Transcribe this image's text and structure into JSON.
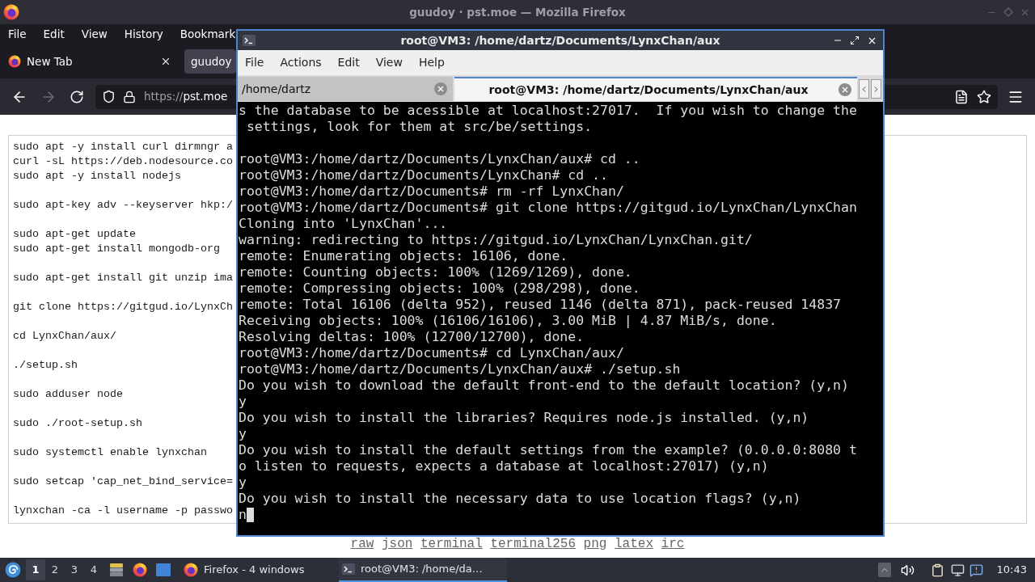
{
  "firefox": {
    "title": "guudoy · pst.moe — Mozilla Firefox",
    "menu": [
      "File",
      "Edit",
      "View",
      "History",
      "Bookmark"
    ],
    "tabs": [
      {
        "label": "New Tab",
        "kind": "new_tab",
        "selected": false,
        "closable": true
      },
      {
        "label": "guudoy",
        "kind": "page",
        "selected": true,
        "closable": false
      }
    ],
    "back": {
      "disabled": false
    },
    "forward": {
      "disabled": true
    },
    "url": {
      "scheme": "https://",
      "host": "pst.moe"
    },
    "page": {
      "code_blocks": [
        [
          "sudo apt -y install curl dirmngr a",
          "curl -sL https://deb.nodesource.co",
          "sudo apt -y install nodejs"
        ],
        [
          "sudo apt-key adv --keyserver hkp:/"
        ],
        [
          "sudo apt-get update",
          "sudo apt-get install mongodb-org"
        ],
        [
          "sudo apt-get install git unzip ima"
        ],
        [
          "git clone https://gitgud.io/LynxCh"
        ],
        [
          "cd LynxChan/aux/"
        ],
        [
          "./setup.sh"
        ],
        [
          "sudo adduser node"
        ],
        [
          "sudo ./root-setup.sh"
        ],
        [
          "sudo systemctl enable lynxchan"
        ],
        [
          "sudo setcap 'cap_net_bind_service="
        ],
        [
          "lynxchan -ca -l username -p passwo"
        ]
      ],
      "links": [
        "raw",
        "json",
        "terminal",
        "terminal256",
        "png",
        "latex",
        "irc"
      ]
    }
  },
  "terminal": {
    "title": "root@VM3: /home/dartz/Documents/LynxChan/aux",
    "menu": [
      "File",
      "Actions",
      "Edit",
      "View",
      "Help"
    ],
    "tabs": [
      {
        "label": "/home/dartz",
        "selected": false
      },
      {
        "label": "root@VM3: /home/dartz/Documents/LynxChan/aux",
        "selected": true
      }
    ],
    "output_blocks": [
      [
        "s the database to be acessible at localhost:27017.  If you wish to change the",
        " settings, look for them at src/be/settings."
      ],
      [
        "root@VM3:/home/dartz/Documents/LynxChan/aux# cd ..",
        "root@VM3:/home/dartz/Documents/LynxChan# cd ..",
        "root@VM3:/home/dartz/Documents# rm -rf LynxChan/",
        "root@VM3:/home/dartz/Documents# git clone https://gitgud.io/LynxChan/LynxChan",
        "Cloning into 'LynxChan'...",
        "warning: redirecting to https://gitgud.io/LynxChan/LynxChan.git/",
        "remote: Enumerating objects: 16106, done.",
        "remote: Counting objects: 100% (1269/1269), done.",
        "remote: Compressing objects: 100% (298/298), done.",
        "remote: Total 16106 (delta 952), reused 1146 (delta 871), pack-reused 14837",
        "Receiving objects: 100% (16106/16106), 3.00 MiB | 4.87 MiB/s, done.",
        "Resolving deltas: 100% (12700/12700), done.",
        "root@VM3:/home/dartz/Documents# cd LynxChan/aux/",
        "root@VM3:/home/dartz/Documents/LynxChan/aux# ./setup.sh",
        "Do you wish to download the default front-end to the default location? (y,n)",
        "y",
        "Do you wish to install the libraries? Requires node.js installed. (y,n)",
        "y",
        "Do you wish to install the default settings from the example? (0.0.0.0:8080 t",
        "o listen to requests, expects a database at localhost:27017) (y,n)",
        "y",
        "Do you wish to install the necessary data to use location flags? (y,n)",
        "n"
      ]
    ],
    "cursor_visible": true
  },
  "taskbar": {
    "workspaces": [
      {
        "label": "1",
        "selected": true
      },
      {
        "label": "2",
        "selected": false
      },
      {
        "label": "3",
        "selected": false
      },
      {
        "label": "4",
        "selected": false
      }
    ],
    "tasks": [
      {
        "label": "Firefox - 4 windows",
        "kind": "browser",
        "selected": false
      },
      {
        "label": "root@VM3: /home/da…",
        "kind": "terminal",
        "selected": true
      }
    ],
    "clock": "10:43"
  }
}
